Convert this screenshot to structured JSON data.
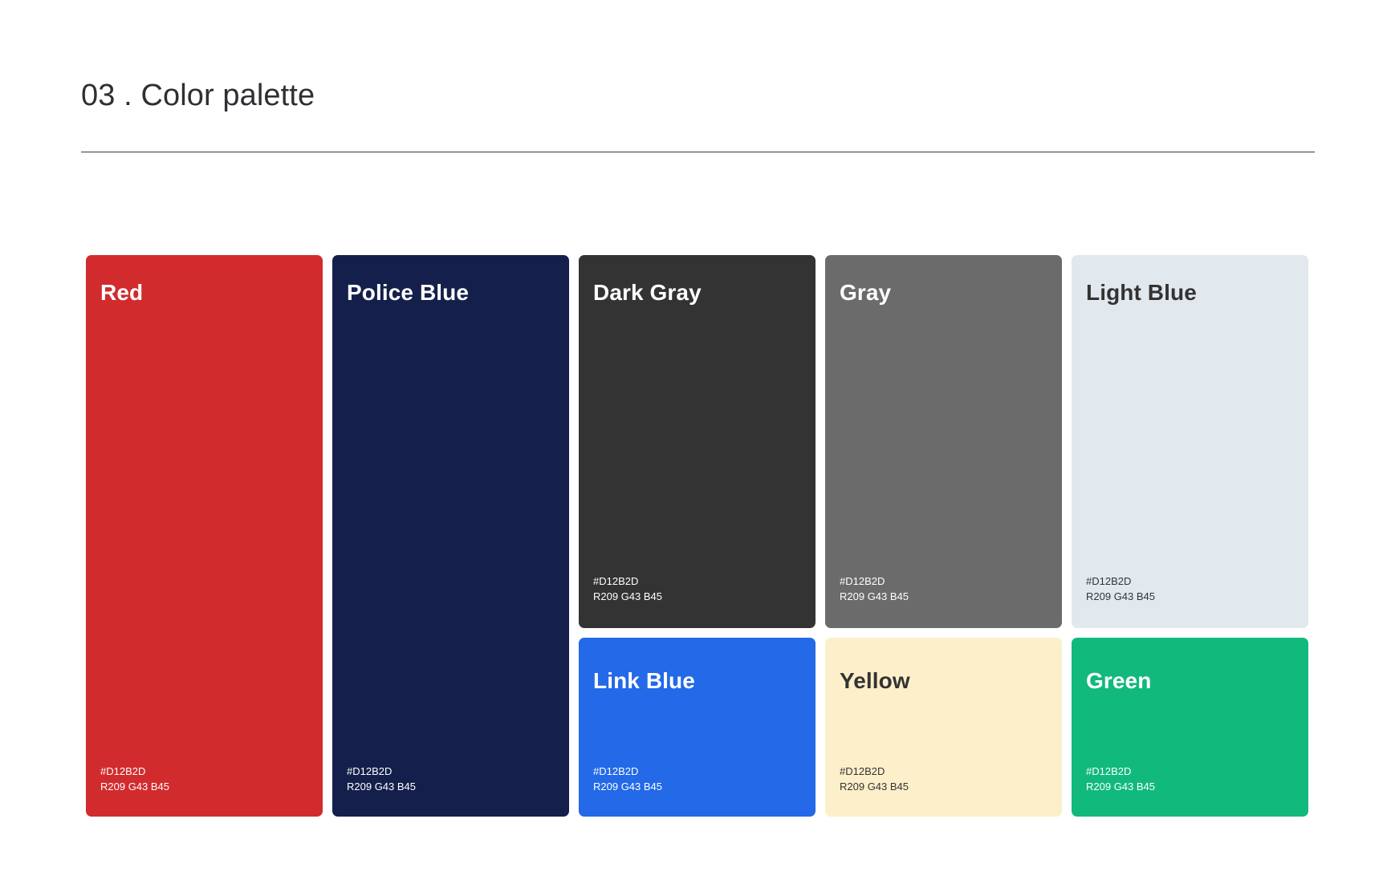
{
  "header": {
    "title": "03 . Color palette"
  },
  "swatches": [
    {
      "name": "Red",
      "hex": "#D12B2D",
      "rgb": "R209 G43 B45",
      "fill": "#d12b2d"
    },
    {
      "name": "Police Blue",
      "hex": "#D12B2D",
      "rgb": "R209 G43 B45",
      "fill": "#14204b"
    },
    {
      "name": "Dark Gray",
      "hex": "#D12B2D",
      "rgb": "R209 G43 B45",
      "fill": "#333333"
    },
    {
      "name": "Gray",
      "hex": "#D12B2D",
      "rgb": "R209 G43 B45",
      "fill": "#6b6b6b"
    },
    {
      "name": "Light Blue",
      "hex": "#D12B2D",
      "rgb": "R209 G43 B45",
      "fill": "#e2e9ee"
    },
    {
      "name": "Link Blue",
      "hex": "#D12B2D",
      "rgb": "R209 G43 B45",
      "fill": "#2369e8"
    },
    {
      "name": "Yellow",
      "hex": "#D12B2D",
      "rgb": "R209 G43 B45",
      "fill": "#fdefca"
    },
    {
      "name": "Green",
      "hex": "#D12B2D",
      "rgb": "R209 G43 B45",
      "fill": "#11b97d"
    }
  ]
}
